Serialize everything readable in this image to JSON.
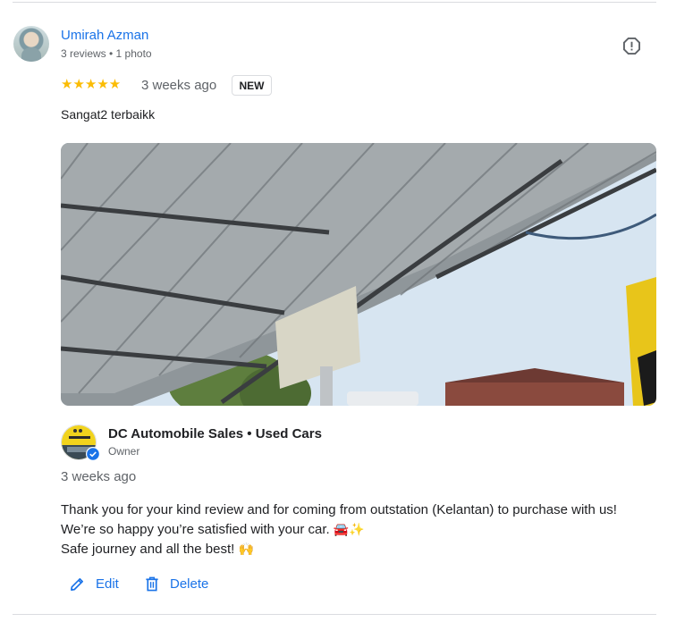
{
  "review": {
    "reviewer_name": "Umirah Azman",
    "reviewer_meta": "3 reviews • 1 photo",
    "stars": "★★★★★",
    "rating": 5,
    "time": "3 weeks ago",
    "badge": "NEW",
    "text": "Sangat2 terbaikk"
  },
  "reply": {
    "owner_name": "DC Automobile Sales • Used Cars",
    "owner_role": "Owner",
    "time": "3 weeks ago",
    "line1": "Thank you for your kind review and for coming from outstation (Kelantan) to purchase with us!",
    "line2_text": "We’re so happy you’re satisfied with your car.",
    "line2_emoji": "🚘✨",
    "line3_text": "Safe journey and all the best!",
    "line3_emoji": "🙌"
  },
  "actions": {
    "edit_label": "Edit",
    "delete_label": "Delete"
  },
  "icons": {
    "report": "flag-icon",
    "edit": "pencil-icon",
    "delete": "trash-icon",
    "verified": "verified-check-icon"
  },
  "colors": {
    "link": "#1a73e8",
    "star": "#fbbc04",
    "muted": "#5f6368"
  }
}
